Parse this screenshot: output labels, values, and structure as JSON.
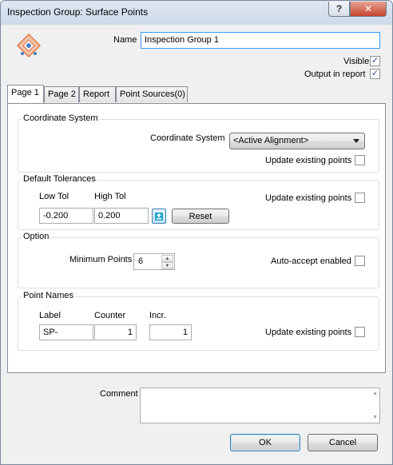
{
  "window": {
    "title": "Inspection Group: Surface Points",
    "help_glyph": "?",
    "close_glyph": "✕"
  },
  "header": {
    "name_label": "Name",
    "name_value": "Inspection Group 1",
    "visible_label": "Visible",
    "visible_checked": true,
    "output_label": "Output in report",
    "output_checked": true
  },
  "tabs": [
    "Page 1",
    "Page 2",
    "Report",
    "Point Sources(0)"
  ],
  "active_tab": "Page 1",
  "coordinate_system": {
    "group_title": "Coordinate System",
    "label": "Coordinate System",
    "selected": "<Active Alignment>",
    "update_label": "Update existing points",
    "update_checked": false
  },
  "default_tolerances": {
    "group_title": "Default Tolerances",
    "low_label": "Low Tol",
    "high_label": "High Tol",
    "low_value": "-0.200",
    "high_value": "0.200",
    "reset_label": "Reset",
    "update_label": "Update existing points",
    "update_checked": false
  },
  "option": {
    "group_title": "Option",
    "min_points_label": "Minimum Points",
    "min_points_value": "6",
    "auto_accept_label": "Auto-accept enabled",
    "auto_accept_checked": false
  },
  "point_names": {
    "group_title": "Point Names",
    "label_header": "Label",
    "counter_header": "Counter",
    "incr_header": "Incr.",
    "label_value": "SP-",
    "counter_value": "1",
    "incr_value": "1",
    "update_label": "Update existing points",
    "update_checked": false
  },
  "footer": {
    "comment_label": "Comment",
    "comment_value": "",
    "ok_label": "OK",
    "cancel_label": "Cancel"
  },
  "icons": {
    "app": "inspection-group-icon",
    "tolerance": "tolerance-swap-icon"
  },
  "colors": {
    "check": "#2b4a7e",
    "accent": "#3c7fb1",
    "close": "#c7442e"
  }
}
